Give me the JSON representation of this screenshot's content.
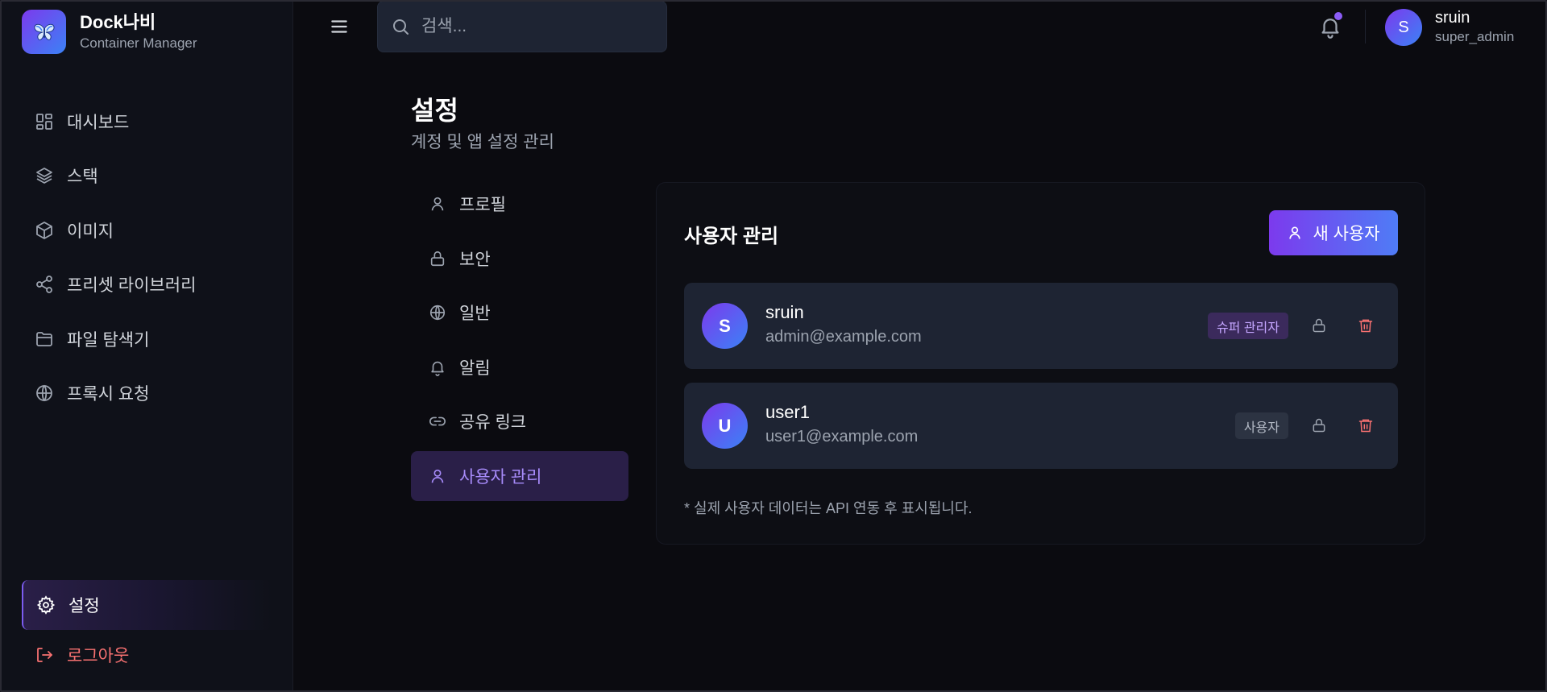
{
  "app": {
    "name": "Dock나비",
    "subtitle": "Container Manager"
  },
  "sidebar": {
    "items": [
      {
        "label": "대시보드",
        "icon": "dashboard-icon"
      },
      {
        "label": "스택",
        "icon": "layers-icon"
      },
      {
        "label": "이미지",
        "icon": "box-icon"
      },
      {
        "label": "프리셋 라이브러리",
        "icon": "share-icon"
      },
      {
        "label": "파일 탐색기",
        "icon": "folder-icon"
      },
      {
        "label": "프록시 요청",
        "icon": "globe-icon"
      }
    ],
    "settings_label": "설정",
    "logout_label": "로그아웃"
  },
  "topbar": {
    "search_placeholder": "검색...",
    "user_name": "sruin",
    "user_role": "super_admin",
    "user_initial": "S",
    "has_notification": true
  },
  "page": {
    "title": "설정",
    "subtitle": "계정 및 앱 설정 관리"
  },
  "settings_nav": {
    "items": [
      {
        "label": "프로필",
        "icon": "user-icon"
      },
      {
        "label": "보안",
        "icon": "lock-icon"
      },
      {
        "label": "일반",
        "icon": "globe-icon"
      },
      {
        "label": "알림",
        "icon": "bell-icon"
      },
      {
        "label": "공유 링크",
        "icon": "link-icon"
      },
      {
        "label": "사용자 관리",
        "icon": "user-icon",
        "active": true
      }
    ]
  },
  "user_management": {
    "title": "사용자 관리",
    "new_user_label": "새 사용자",
    "users": [
      {
        "initial": "S",
        "name": "sruin",
        "email": "admin@example.com",
        "role": "슈퍼 관리자"
      },
      {
        "initial": "U",
        "name": "user1",
        "email": "user1@example.com",
        "role": "사용자"
      }
    ],
    "note": "* 실제 사용자 데이터는 API 연동 후 표시됩니다."
  },
  "colors": {
    "accent": "#8b5cf6",
    "accent_blue": "#3b82f6",
    "danger": "#f87171",
    "background": "#0b0b10",
    "panel": "#1e2433"
  }
}
